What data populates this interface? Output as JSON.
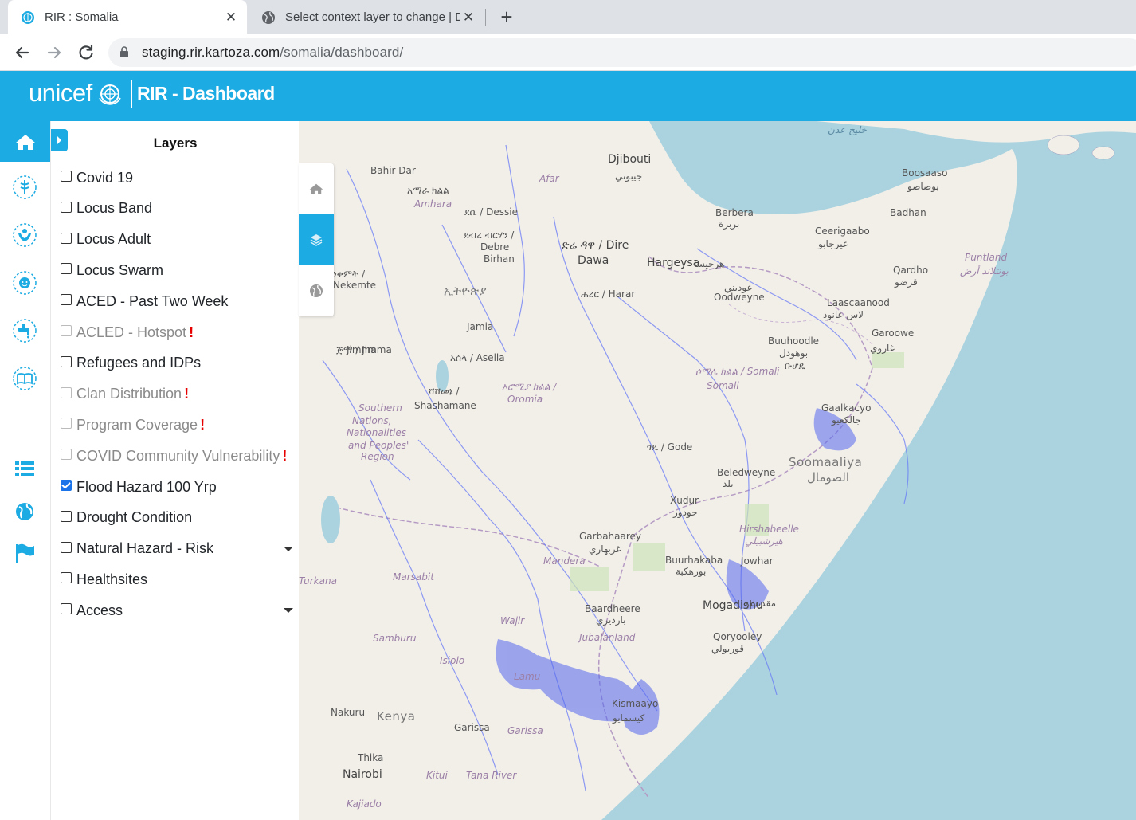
{
  "browser": {
    "tabs": [
      {
        "title": "RIR : Somalia",
        "active": true
      },
      {
        "title": "Select context layer to change | D",
        "active": false
      }
    ],
    "url_host": "staging.rir.kartoza.com",
    "url_path": "/somalia/dashboard/"
  },
  "header": {
    "logo": "unicef",
    "title": "RIR - Dashboard",
    "color": "#1cabe2"
  },
  "rail": {
    "icons": [
      "home-icon",
      "health-icon",
      "child-protection-icon",
      "child-face-icon",
      "water-tap-icon",
      "education-book-icon",
      "list-icon",
      "globe-icon",
      "flag-icon"
    ]
  },
  "layers": {
    "title": "Layers",
    "items": [
      {
        "label": "Covid 19",
        "checked": false,
        "disabled": false,
        "warning": false,
        "dropdown": false
      },
      {
        "label": "Locus Band",
        "checked": false,
        "disabled": false,
        "warning": false,
        "dropdown": false
      },
      {
        "label": "Locus Adult",
        "checked": false,
        "disabled": false,
        "warning": false,
        "dropdown": false
      },
      {
        "label": "Locus Swarm",
        "checked": false,
        "disabled": false,
        "warning": false,
        "dropdown": false
      },
      {
        "label": "ACED - Past Two Week",
        "checked": false,
        "disabled": false,
        "warning": false,
        "dropdown": false
      },
      {
        "label": "ACLED - Hotspot",
        "checked": false,
        "disabled": true,
        "warning": true,
        "dropdown": false
      },
      {
        "label": "Refugees and IDPs",
        "checked": false,
        "disabled": false,
        "warning": false,
        "dropdown": false
      },
      {
        "label": "Clan Distribution",
        "checked": false,
        "disabled": true,
        "warning": true,
        "dropdown": false
      },
      {
        "label": "Program Coverage",
        "checked": false,
        "disabled": true,
        "warning": true,
        "dropdown": false
      },
      {
        "label": "COVID Community Vulnerability",
        "checked": false,
        "disabled": true,
        "warning": true,
        "dropdown": false
      },
      {
        "label": "Flood Hazard 100 Yrp",
        "checked": true,
        "disabled": false,
        "warning": false,
        "dropdown": false
      },
      {
        "label": "Drought Condition",
        "checked": false,
        "disabled": false,
        "warning": false,
        "dropdown": false
      },
      {
        "label": "Natural Hazard - Risk",
        "checked": false,
        "disabled": false,
        "warning": false,
        "dropdown": true
      },
      {
        "label": "Healthsites",
        "checked": false,
        "disabled": false,
        "warning": false,
        "dropdown": false
      },
      {
        "label": "Access",
        "checked": false,
        "disabled": false,
        "warning": false,
        "dropdown": true
      }
    ],
    "warning_mark": "!"
  },
  "map_tools": [
    "home-icon",
    "layers-icon",
    "globe-icon"
  ],
  "map": {
    "labels": [
      {
        "text": "Djibouti",
        "cls": "big"
      },
      {
        "text": "جيبوتي",
        "cls": ""
      },
      {
        "text": "خليج عدن",
        "cls": "sea"
      },
      {
        "text": "Boosaaso",
        "cls": ""
      },
      {
        "text": "بوصاصو",
        "cls": ""
      },
      {
        "text": "Berbera",
        "cls": ""
      },
      {
        "text": "بربرة",
        "cls": ""
      },
      {
        "text": "Badhan",
        "cls": ""
      },
      {
        "text": "Ceerigaabo",
        "cls": ""
      },
      {
        "text": "عيرجابو",
        "cls": ""
      },
      {
        "text": "Puntland",
        "cls": "region"
      },
      {
        "text": "بونتلاند أرض",
        "cls": "region"
      },
      {
        "text": "Qardho",
        "cls": ""
      },
      {
        "text": "قرضو",
        "cls": ""
      },
      {
        "text": "ድሬ ዳዋ / Dire",
        "cls": "big"
      },
      {
        "text": "Dawa",
        "cls": "big"
      },
      {
        "text": "Hargeysa",
        "cls": "big"
      },
      {
        "text": "هرجيسا",
        "cls": ""
      },
      {
        "text": "ሐረር / Harar",
        "cls": ""
      },
      {
        "text": "Oodweyne",
        "cls": ""
      },
      {
        "text": "عوديني",
        "cls": ""
      },
      {
        "text": "Laascaanood",
        "cls": ""
      },
      {
        "text": "لاس عانود",
        "cls": ""
      },
      {
        "text": "Garoowe",
        "cls": ""
      },
      {
        "text": "غاروي",
        "cls": ""
      },
      {
        "text": "Buuhoodle",
        "cls": ""
      },
      {
        "text": "بوهودل",
        "cls": ""
      },
      {
        "text": "ቡሆዴ",
        "cls": ""
      },
      {
        "text": "ሶማሌ ክልል / Somali",
        "cls": "region"
      },
      {
        "text": "Somali",
        "cls": "region"
      },
      {
        "text": "Gaalkacyo",
        "cls": ""
      },
      {
        "text": "جالكعيو",
        "cls": ""
      },
      {
        "text": "ጎዴ / Gode",
        "cls": ""
      },
      {
        "text": "Soomaaliya",
        "cls": "country"
      },
      {
        "text": "الصومال",
        "cls": "country"
      },
      {
        "text": "Beledweyne",
        "cls": ""
      },
      {
        "text": "بلد",
        "cls": ""
      },
      {
        "text": "Xudur",
        "cls": ""
      },
      {
        "text": "حودور",
        "cls": ""
      },
      {
        "text": "Hirshabeelle",
        "cls": "region"
      },
      {
        "text": "هيرشبيلي",
        "cls": "region"
      },
      {
        "text": "Garbahaarey",
        "cls": ""
      },
      {
        "text": "غربهاري",
        "cls": ""
      },
      {
        "text": "Buurhakaba",
        "cls": ""
      },
      {
        "text": "بورهكبة",
        "cls": ""
      },
      {
        "text": "Mandera",
        "cls": "region"
      },
      {
        "text": "Baardheere",
        "cls": ""
      },
      {
        "text": "بارديري",
        "cls": ""
      },
      {
        "text": "Mogadishu",
        "cls": "big"
      },
      {
        "text": "مقديشو",
        "cls": ""
      },
      {
        "text": "Qoryooley",
        "cls": ""
      },
      {
        "text": "قوريولي",
        "cls": ""
      },
      {
        "text": "Jubalanland",
        "cls": "region"
      },
      {
        "text": "Kismaayo",
        "cls": ""
      },
      {
        "text": "كيسمايو",
        "cls": ""
      },
      {
        "text": "Wajir",
        "cls": "region"
      },
      {
        "text": "Marsabit",
        "cls": "region"
      },
      {
        "text": "Samburu",
        "cls": "region"
      },
      {
        "text": "Isiolo",
        "cls": "region"
      },
      {
        "text": "Garissa",
        "cls": ""
      },
      {
        "text": "Garissa",
        "cls": "region"
      },
      {
        "text": "Kenya",
        "cls": "country"
      },
      {
        "text": "Nakuru",
        "cls": ""
      },
      {
        "text": "Thika",
        "cls": ""
      },
      {
        "text": "Nairobi",
        "cls": "big"
      },
      {
        "text": "Kitui",
        "cls": "region"
      },
      {
        "text": "Tana River",
        "cls": "region"
      },
      {
        "text": "Kajiado",
        "cls": "region"
      },
      {
        "text": "Turkana",
        "cls": "region"
      },
      {
        "text": "Bahir Dar",
        "cls": ""
      },
      {
        "text": "አማራ ክልል",
        "cls": ""
      },
      {
        "text": "Amhara",
        "cls": "region"
      },
      {
        "text": "ደሴ / Dessie",
        "cls": ""
      },
      {
        "text": "ደብረ ብርሃን /",
        "cls": ""
      },
      {
        "text": "Debre",
        "cls": ""
      },
      {
        "text": "Birhan",
        "cls": ""
      },
      {
        "text": "ኢትዮጵያ",
        "cls": "country"
      },
      {
        "text": "ነቀምት /",
        "cls": ""
      },
      {
        "text": "Nekemte",
        "cls": ""
      },
      {
        "text": "ጅማ / Jimma",
        "cls": ""
      },
      {
        "text": "Jimma",
        "cls": ""
      },
      {
        "text": "አሰላ / Asella",
        "cls": ""
      },
      {
        "text": "ሻሸመኔ /",
        "cls": ""
      },
      {
        "text": "Shashamane",
        "cls": ""
      },
      {
        "text": "ኦሮሚያ ክልል /",
        "cls": "region"
      },
      {
        "text": "Oromia",
        "cls": "region"
      },
      {
        "text": "Southern",
        "cls": "region"
      },
      {
        "text": "Nations,",
        "cls": "region"
      },
      {
        "text": "Nationalities",
        "cls": "region"
      },
      {
        "text": "and Peoples'",
        "cls": "region"
      },
      {
        "text": "Region",
        "cls": "region"
      },
      {
        "text": "Afar",
        "cls": "region"
      },
      {
        "text": "Jamia",
        "cls": ""
      },
      {
        "text": "Jowhar",
        "cls": ""
      },
      {
        "text": "Lamu",
        "cls": "region"
      }
    ]
  }
}
